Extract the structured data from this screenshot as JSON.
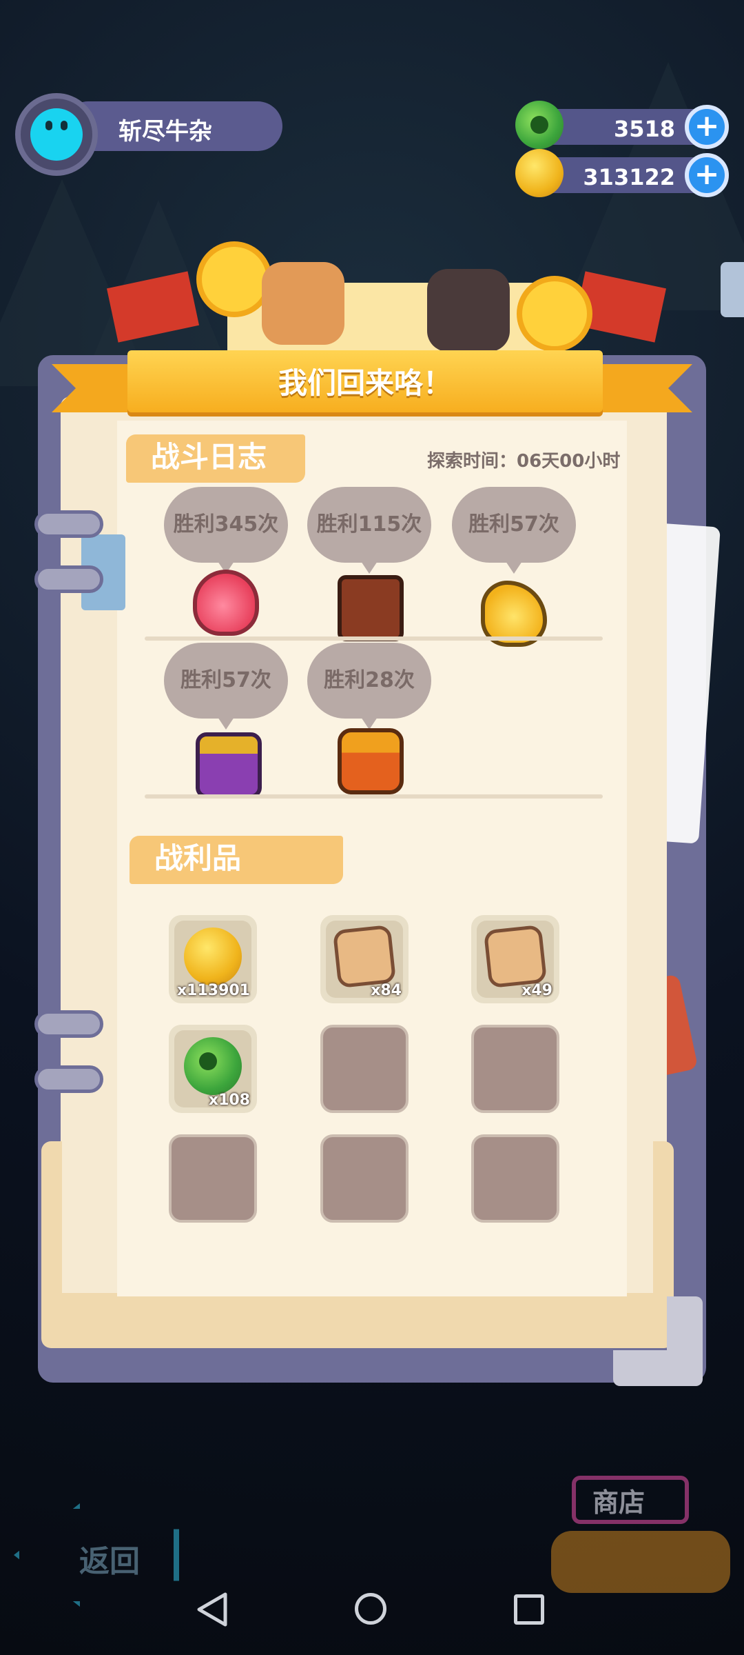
{
  "player": {
    "name": "斩尽牛杂",
    "avatar_icon": "cat-avatar-icon"
  },
  "currencies": [
    {
      "icon": "green-gem-icon",
      "value": "3518",
      "add_label": "+"
    },
    {
      "icon": "gold-coin-icon",
      "value": "313122",
      "add_label": "+"
    }
  ],
  "banner": {
    "title": "我们回来咯！"
  },
  "battle_log": {
    "title": "战斗日志",
    "explore_time": "探索时间：06天00小时",
    "entries": [
      {
        "label": "胜利345次",
        "monster": "pink-slime-icon"
      },
      {
        "label": "胜利115次",
        "monster": "mimic-chest-icon"
      },
      {
        "label": "胜利57次",
        "monster": "yellow-slime-icon"
      },
      {
        "label": "胜利57次",
        "monster": "purple-chest-icon"
      },
      {
        "label": "胜利28次",
        "monster": "orange-chest-icon"
      }
    ]
  },
  "loot": {
    "title": "战利品",
    "items": [
      {
        "icon": "gold-coin-icon",
        "qty": "x113901"
      },
      {
        "icon": "treasure-map-icon",
        "qty": "x84"
      },
      {
        "icon": "treasure-map-icon",
        "qty": "x49"
      },
      {
        "icon": "green-gem-icon",
        "qty": "x108"
      },
      {
        "icon": "",
        "qty": ""
      },
      {
        "icon": "",
        "qty": ""
      },
      {
        "icon": "",
        "qty": ""
      },
      {
        "icon": "",
        "qty": ""
      },
      {
        "icon": "",
        "qty": ""
      }
    ]
  },
  "bottom": {
    "back_label": "返回",
    "shop_label": "商店"
  },
  "colors": {
    "accent_blue": "#2b93f0",
    "banner_yellow": "#ffd452",
    "paper": "#f6ead2",
    "bubble": "#b8aaa6"
  }
}
